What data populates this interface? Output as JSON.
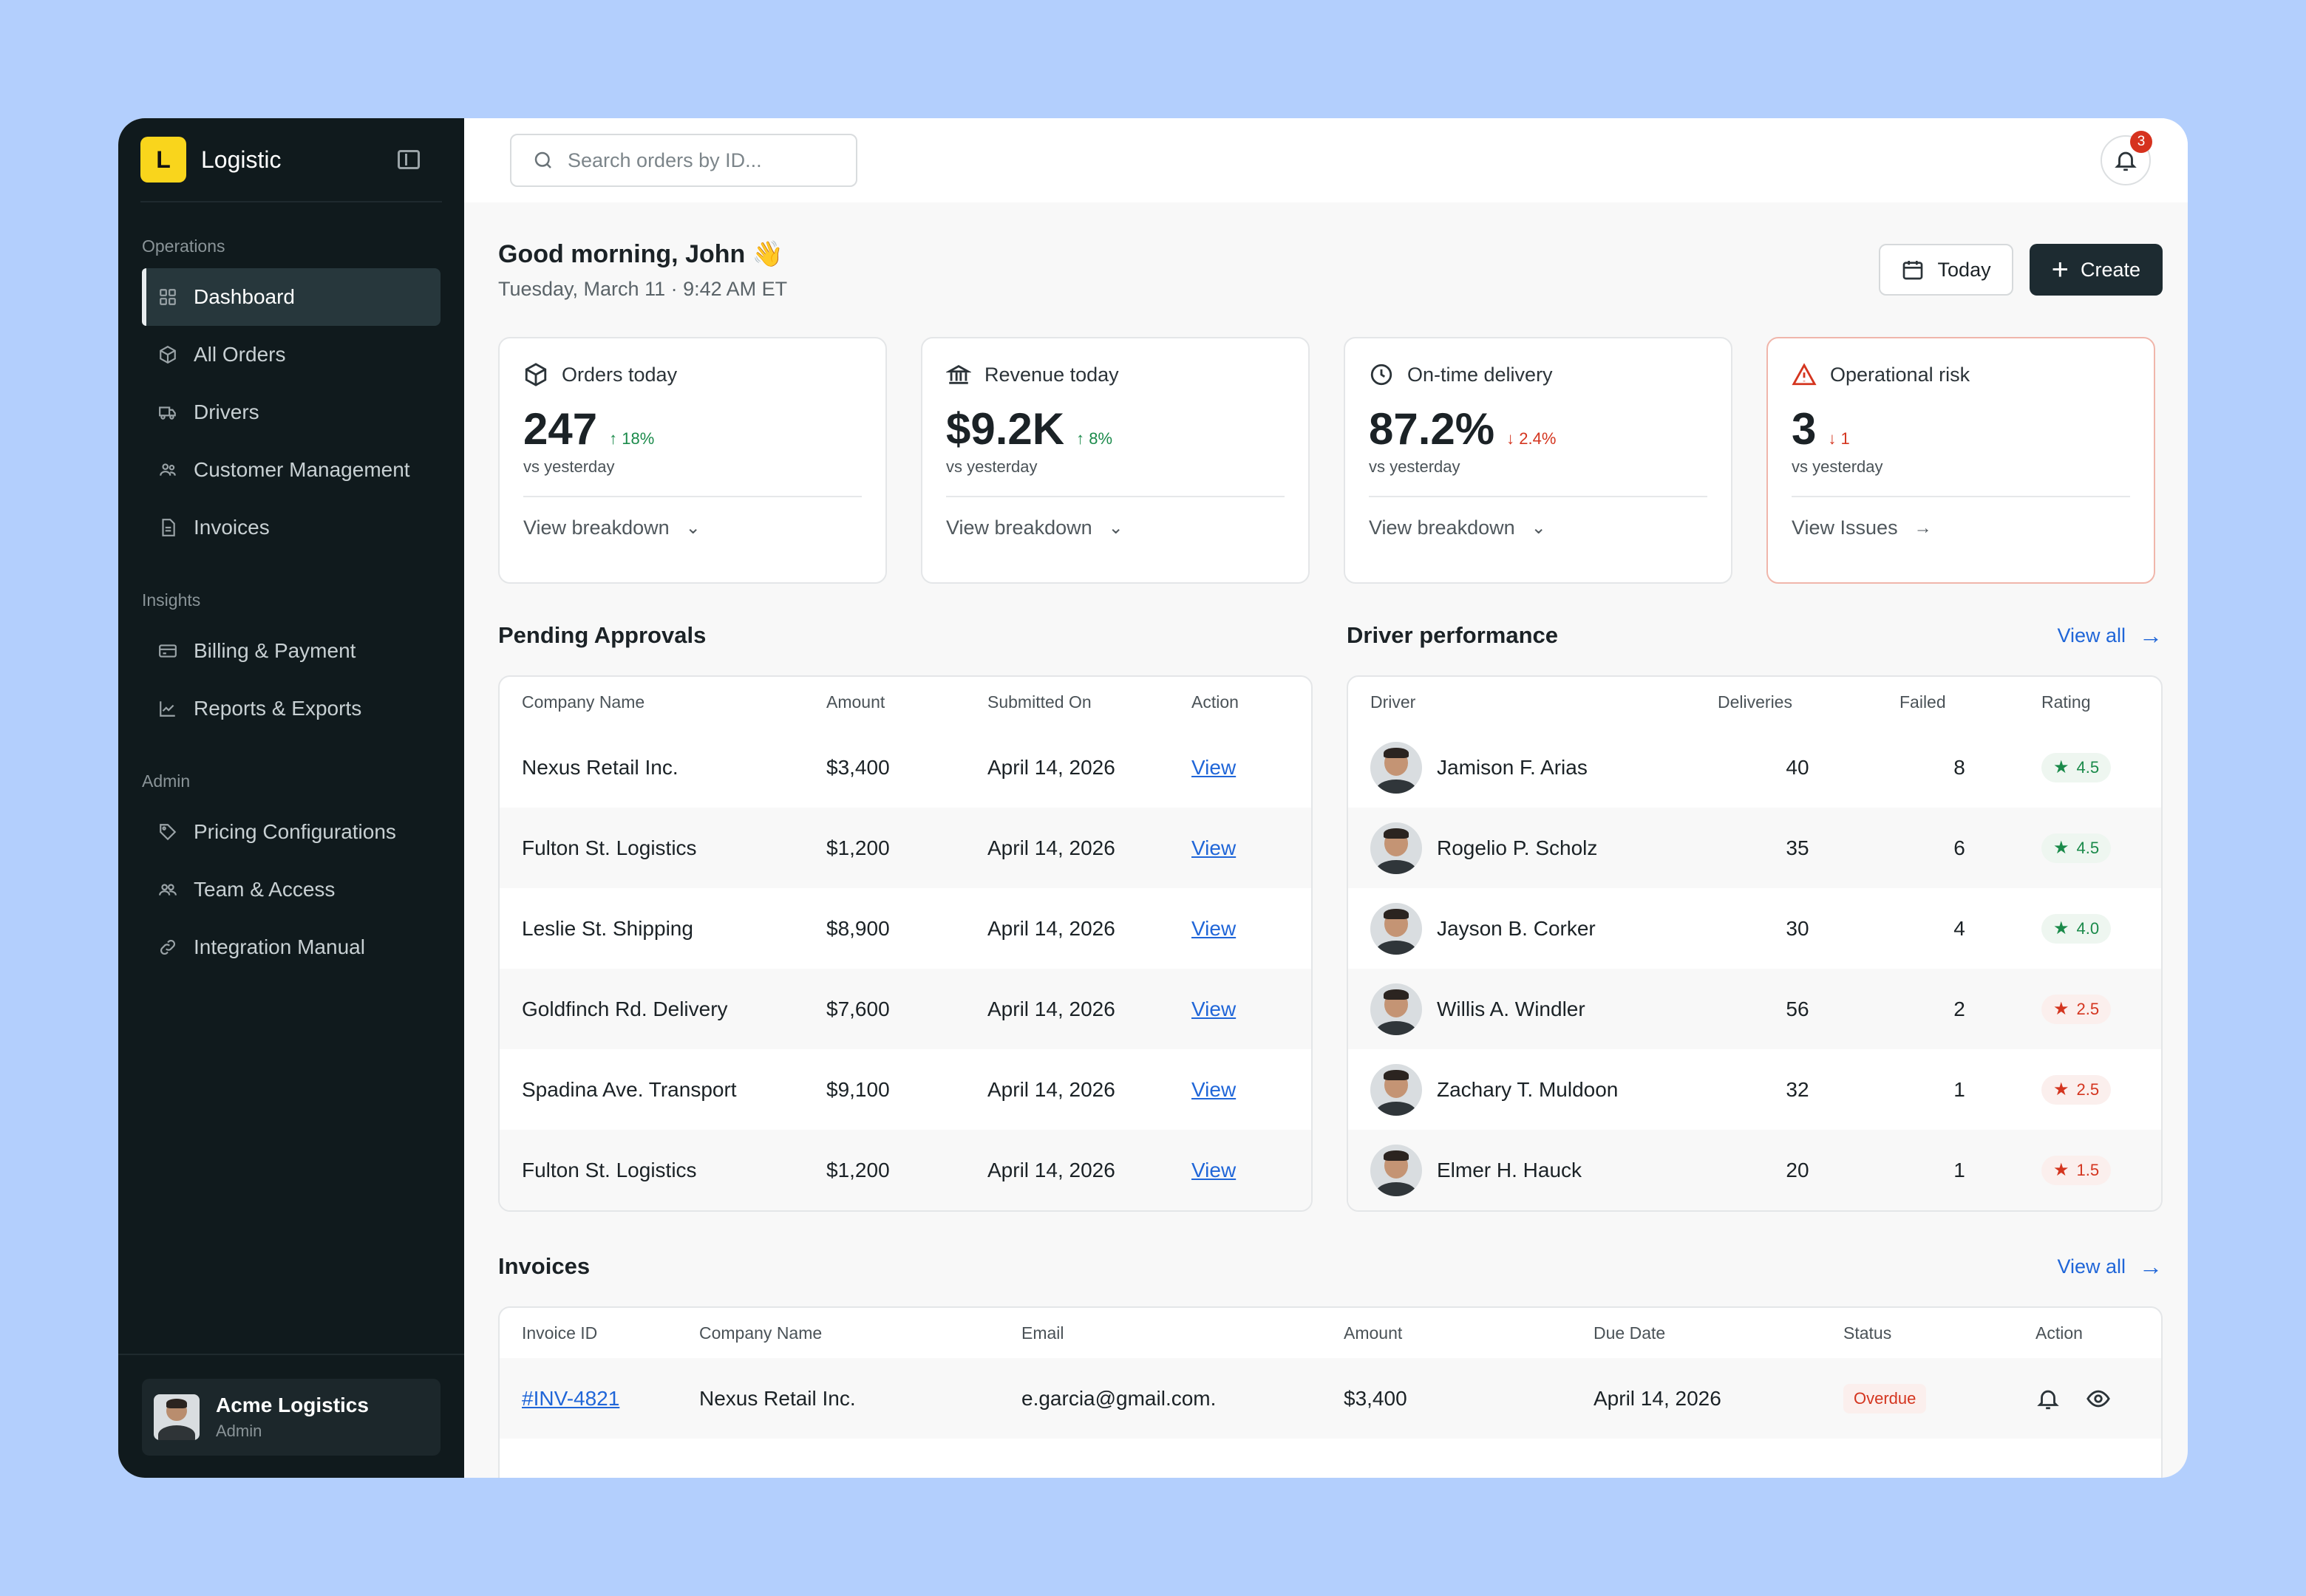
{
  "brand": {
    "logo_letter": "L",
    "name": "Logistic"
  },
  "sidebar": {
    "sections": [
      {
        "label": "Operations",
        "items": [
          {
            "label": "Dashboard",
            "icon": "grid-icon",
            "active": true
          },
          {
            "label": "All Orders",
            "icon": "box-icon"
          },
          {
            "label": "Drivers",
            "icon": "truck-icon"
          },
          {
            "label": "Customer Management",
            "icon": "users-icon"
          },
          {
            "label": "Invoices",
            "icon": "file-icon"
          }
        ]
      },
      {
        "label": "Insights",
        "items": [
          {
            "label": "Billing & Payment",
            "icon": "credit-card-icon"
          },
          {
            "label": "Reports & Exports",
            "icon": "chart-line-icon"
          }
        ]
      },
      {
        "label": "Admin",
        "items": [
          {
            "label": "Pricing Configurations",
            "icon": "tag-icon"
          },
          {
            "label": "Team & Access",
            "icon": "team-icon"
          },
          {
            "label": "Integration Manual",
            "icon": "link-icon"
          }
        ]
      }
    ],
    "user": {
      "name": "Acme Logistics",
      "role": "Admin"
    }
  },
  "topbar": {
    "search_placeholder": "Search orders by ID...",
    "notifications_count": "3"
  },
  "greeting": {
    "title": "Good morning, John 👋",
    "date": "Tuesday, March 11 · 9:42 AM ET"
  },
  "actions": {
    "today_label": "Today",
    "create_label": "Create"
  },
  "stats": [
    {
      "title": "Orders today",
      "value": "247",
      "delta": "↑ 18%",
      "trend": "up",
      "sub": "vs yesterday",
      "link": "View breakdown",
      "link_icon": "chevron-down"
    },
    {
      "title": "Revenue today",
      "value": "$9.2K",
      "delta": "↑ 8%",
      "trend": "up",
      "sub": "vs yesterday",
      "link": "View breakdown",
      "link_icon": "chevron-down"
    },
    {
      "title": "On-time delivery",
      "value": "87.2%",
      "delta": "↓ 2.4%",
      "trend": "down",
      "sub": "vs yesterday",
      "link": "View breakdown",
      "link_icon": "chevron-down"
    },
    {
      "title": "Operational risk",
      "value": "3",
      "delta": "↓ 1",
      "trend": "down",
      "sub": "vs yesterday",
      "link": "View Issues",
      "link_icon": "arrow-right"
    }
  ],
  "pending": {
    "title": "Pending Approvals",
    "columns": [
      "Company Name",
      "Amount",
      "Submitted On",
      "Action"
    ],
    "rows": [
      {
        "company": "Nexus Retail Inc.",
        "amount": "$3,400",
        "date": "April 14, 2026",
        "action": "View"
      },
      {
        "company": "Fulton St. Logistics",
        "amount": "$1,200",
        "date": "April 14, 2026",
        "action": "View"
      },
      {
        "company": "Leslie St. Shipping",
        "amount": "$8,900",
        "date": "April 14, 2026",
        "action": "View"
      },
      {
        "company": "Goldfinch Rd. Delivery",
        "amount": "$7,600",
        "date": "April 14, 2026",
        "action": "View"
      },
      {
        "company": "Spadina Ave. Transport",
        "amount": "$9,100",
        "date": "April 14, 2026",
        "action": "View"
      },
      {
        "company": "Fulton St. Logistics",
        "amount": "$1,200",
        "date": "April 14, 2026",
        "action": "View"
      }
    ]
  },
  "drivers": {
    "title": "Driver performance",
    "view_all": "View all",
    "columns": [
      "Driver",
      "Deliveries",
      "Failed",
      "Rating"
    ],
    "rows": [
      {
        "name": "Jamison F. Arias",
        "deliveries": "40",
        "failed": "8",
        "rating": "4.5",
        "tone": "good"
      },
      {
        "name": "Rogelio P. Scholz",
        "deliveries": "35",
        "failed": "6",
        "rating": "4.5",
        "tone": "good"
      },
      {
        "name": "Jayson B. Corker",
        "deliveries": "30",
        "failed": "4",
        "rating": "4.0",
        "tone": "good"
      },
      {
        "name": "Willis A. Windler",
        "deliveries": "56",
        "failed": "2",
        "rating": "2.5",
        "tone": "bad"
      },
      {
        "name": "Zachary T. Muldoon",
        "deliveries": "32",
        "failed": "1",
        "rating": "2.5",
        "tone": "bad"
      },
      {
        "name": "Elmer H. Hauck",
        "deliveries": "20",
        "failed": "1",
        "rating": "1.5",
        "tone": "bad"
      }
    ]
  },
  "invoices": {
    "title": "Invoices",
    "view_all": "View all",
    "columns": [
      "Invoice ID",
      "Company Name",
      "Email",
      "Amount",
      "Due Date",
      "Status",
      "Action"
    ],
    "rows": [
      {
        "id": "#INV-4821",
        "company": "Nexus Retail Inc.",
        "email": "e.garcia@gmail.com.",
        "amount": "$3,400",
        "due": "April 14, 2026",
        "status": "Overdue"
      }
    ]
  },
  "colors": {
    "sidebar_bg": "#101a1d",
    "accent_yellow": "#f9d51c",
    "link_blue": "#2066d8",
    "up_green": "#1a8a4a",
    "down_red": "#d4351f",
    "page_bg": "#b3cffd"
  }
}
